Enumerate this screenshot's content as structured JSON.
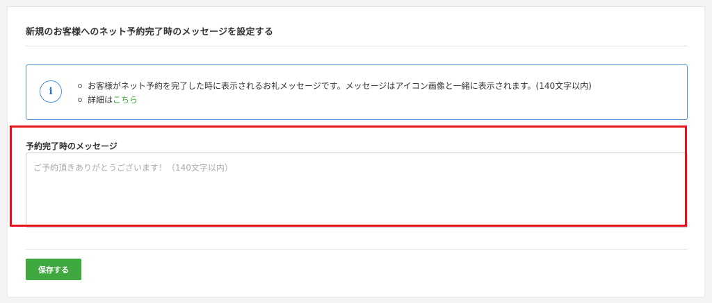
{
  "page": {
    "title": "新規のお客様へのネット予約完了時のメッセージを設定する"
  },
  "info": {
    "icon": "info-icon",
    "line1": "お客様がネット予約を完了した時に表示されるお礼メッセージです。メッセージはアイコン画像と一緒に表示されます。(140文字以内)",
    "line2_prefix": "詳細は",
    "line2_link": "こちら"
  },
  "form": {
    "message_label": "予約完了時のメッセージ",
    "message_value": "",
    "message_placeholder": "ご予約頂きありがとうございます！（140文字以内）"
  },
  "actions": {
    "save_label": "保存する"
  },
  "colors": {
    "accent_green": "#3fa93f",
    "info_blue": "#4a90d9",
    "highlight_red": "#e8101a"
  }
}
